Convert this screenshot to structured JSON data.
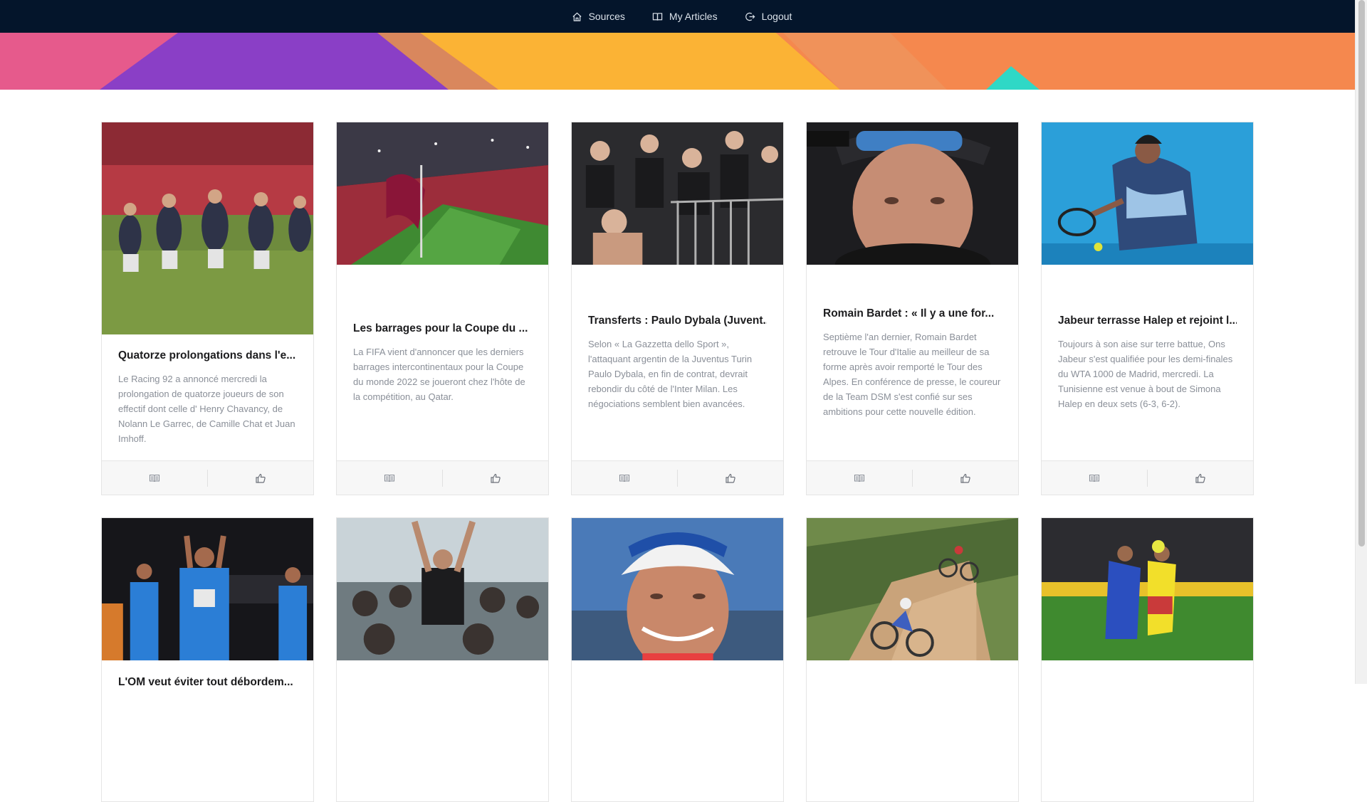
{
  "nav": {
    "items": [
      {
        "label": "Sources",
        "icon": "home-icon"
      },
      {
        "label": "My Articles",
        "icon": "book-icon"
      },
      {
        "label": "Logout",
        "icon": "logout-icon"
      }
    ]
  },
  "colors": {
    "navbar": "#04152b",
    "hero_pink": "#e84f83",
    "hero_purple": "#8a3fc6",
    "hero_yellow": "#fbb335",
    "hero_orange": "#f5884e",
    "hero_teal": "#2fd8c6"
  },
  "articles": [
    {
      "title": "Quatorze prolongations dans l'e...",
      "description": "Le Racing 92 a annoncé mercredi la prolongation de quatorze joueurs de son effectif dont celle d' Henry Chavancy, de Nolann Le Garrec, de Camille Chat et Juan Imhoff.",
      "image": "rugby-players-photo"
    },
    {
      "title": "Les barrages pour la Coupe du ...",
      "description": "La FIFA vient d'annoncer que les derniers barrages intercontinentaux pour la Coupe du monde 2022 se joueront chez l'hôte de la compétition, au Qatar.",
      "image": "qatar-stadium-photo"
    },
    {
      "title": "Transferts : Paulo Dybala (Juvent...",
      "description": "Selon « La Gazzetta dello Sport », l'attaquant argentin de la Juventus Turin Paulo Dybala, en fin de contrat, devrait rebondir du côté de l'Inter Milan. Les négociations semblent bien avancées.",
      "image": "football-fans-photo"
    },
    {
      "title": "Romain Bardet : « Il y a une for...",
      "description": "Septième l'an dernier, Romain Bardet retrouve le Tour d'Italie au meilleur de sa forme après avoir remporté le Tour des Alpes. En conférence de presse, le coureur de la Team DSM s'est confié sur ses ambitions pour cette nouvelle édition.",
      "image": "cyclist-portrait-photo"
    },
    {
      "title": "Jabeur terrasse Halep et rejoint l...",
      "description": "Toujours à son aise sur terre battue, Ons Jabeur s'est qualifiée pour les demi-finales du WTA 1000 de Madrid, mercredi. La Tunisienne est venue à bout de Simona Halep en deux sets (6-3, 6-2).",
      "image": "tennis-player-photo"
    },
    {
      "title": "L'OM veut éviter tout débordem...",
      "image": "om-players-photo"
    },
    {
      "title": "",
      "image": "surfer-crowd-photo"
    },
    {
      "title": "",
      "image": "cyclist-helmet-photo"
    },
    {
      "title": "",
      "image": "mountain-bike-photo"
    },
    {
      "title": "",
      "image": "football-match-photo"
    }
  ]
}
